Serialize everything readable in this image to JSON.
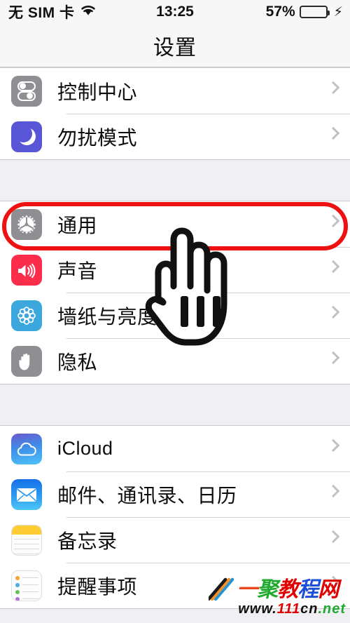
{
  "statusbar": {
    "carrier": "无 SIM 卡",
    "wifi_icon": "wifi-icon",
    "time": "13:25",
    "battery_percent": "57%",
    "battery_level": 57,
    "charging_icon": "lightning-bolt-icon"
  },
  "nav": {
    "title": "设置"
  },
  "groups": [
    {
      "rows": [
        {
          "label": "控制中心",
          "icon": "control-center-icon",
          "chevron": "chevron-right-icon"
        },
        {
          "label": "勿扰模式",
          "icon": "moon-icon",
          "chevron": "chevron-right-icon"
        }
      ]
    },
    {
      "rows": [
        {
          "label": "通用",
          "icon": "gear-icon",
          "chevron": "chevron-right-icon",
          "highlighted": true
        },
        {
          "label": "声音",
          "icon": "speaker-icon",
          "chevron": "chevron-right-icon"
        },
        {
          "label": "墙纸与亮度",
          "icon": "wallpaper-flower-icon",
          "chevron": "chevron-right-icon"
        },
        {
          "label": "隐私",
          "icon": "hand-icon",
          "chevron": "chevron-right-icon"
        }
      ]
    },
    {
      "rows": [
        {
          "label": "iCloud",
          "icon": "cloud-icon",
          "chevron": "chevron-right-icon",
          "latin": true
        },
        {
          "label": "邮件、通讯录、日历",
          "icon": "envelope-icon",
          "chevron": "chevron-right-icon"
        },
        {
          "label": "备忘录",
          "icon": "notes-icon",
          "chevron": "chevron-right-icon"
        },
        {
          "label": "提醒事项",
          "icon": "reminders-icon",
          "chevron": "chevron-right-icon"
        }
      ]
    }
  ],
  "annotation": {
    "highlight_color": "#EE1111",
    "highlight_target": "通用",
    "cursor_icon": "pointing-hand-cursor-icon"
  },
  "watermark": {
    "chars": [
      "一",
      "聚",
      "教",
      "程",
      "网"
    ],
    "url_parts": [
      "www.",
      "111",
      "cn",
      ".",
      "net"
    ],
    "url": "www.111cn.net"
  },
  "colors": {
    "list_background": "#FFFFFF",
    "page_background": "#EFEFF4",
    "separator": "#D4D4D6",
    "chevron": "#C2C2C6",
    "control_center": "#8E8E93",
    "do_not_disturb": "#5856D6",
    "general": "#8E8E93",
    "sounds": "#FB2D4B",
    "wallpaper": "#3BA7DC",
    "privacy": "#8E8E93",
    "notes_accent": "#FFCC33",
    "battery_green": "#32C85A"
  }
}
